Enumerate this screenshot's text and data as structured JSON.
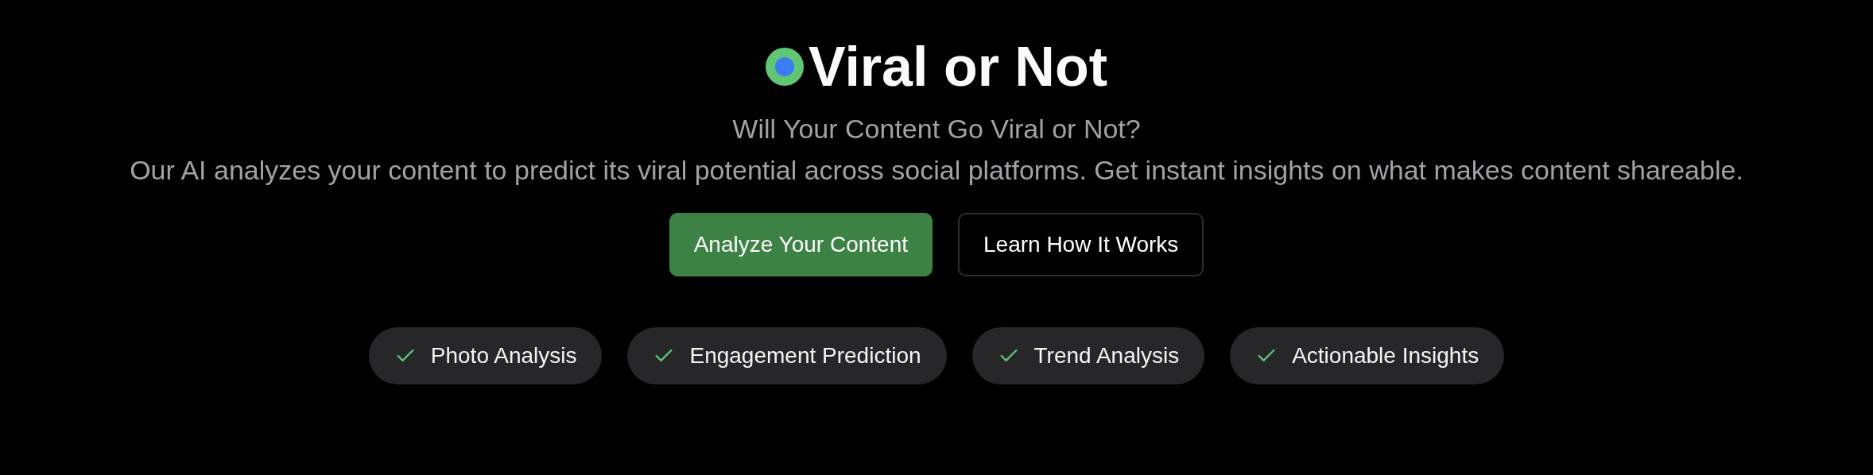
{
  "title": "Viral or Not",
  "subtitle": "Will Your Content Go Viral or Not?",
  "description": "Our AI analyzes your content to predict its viral potential across social platforms. Get instant insights on what makes content shareable.",
  "buttons": [
    {
      "label": "Analyze Your Content",
      "kind": "primary"
    },
    {
      "label": "Learn How It Works",
      "kind": "outline"
    }
  ],
  "features": [
    {
      "label": "Photo Analysis"
    },
    {
      "label": "Engagement Prediction"
    },
    {
      "label": "Trend Analysis"
    },
    {
      "label": "Actionable Insights"
    }
  ]
}
